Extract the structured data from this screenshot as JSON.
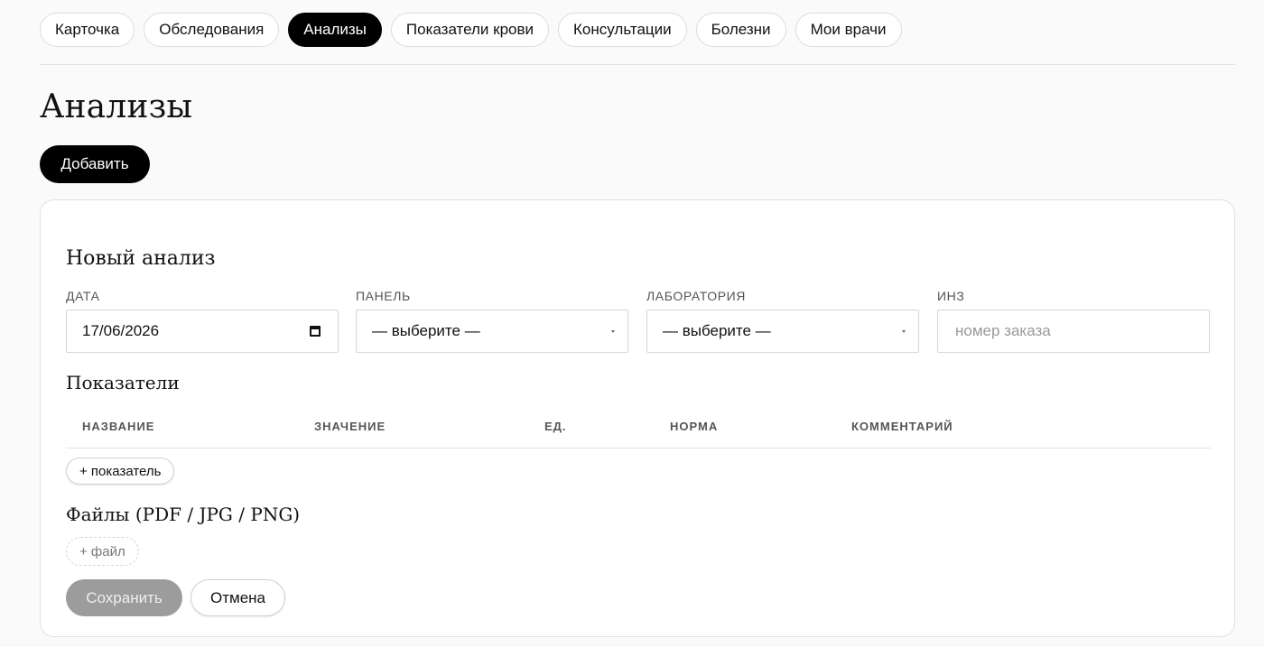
{
  "tabs": [
    {
      "label": "Карточка",
      "active": false
    },
    {
      "label": "Обследования",
      "active": false
    },
    {
      "label": "Анализы",
      "active": true
    },
    {
      "label": "Показатели крови",
      "active": false
    },
    {
      "label": "Консультации",
      "active": false
    },
    {
      "label": "Болезни",
      "active": false
    },
    {
      "label": "Мои врачи",
      "active": false
    }
  ],
  "page": {
    "title": "Анализы",
    "add_label": "Добавить"
  },
  "form": {
    "title": "Новый анализ",
    "date": {
      "label": "ДАТА",
      "value": "17/06/2026",
      "icon": "calendar-icon"
    },
    "panel": {
      "label": "ПАНЕЛЬ",
      "value": "— выберите —"
    },
    "lab": {
      "label": "ЛАБОРАТОРИЯ",
      "value": "— выберите —"
    },
    "inz": {
      "label": "ИНЗ",
      "placeholder": "номер заказа",
      "value": ""
    },
    "indicators": {
      "title": "Показатели",
      "columns": [
        "НАЗВАНИЕ",
        "ЗНАЧЕНИЕ",
        "ЕД.",
        "НОРМА",
        "КОММЕНТАРИЙ"
      ],
      "add_label": "+ показатель"
    },
    "files": {
      "title": "Файлы (PDF / JPG / PNG)",
      "add_label": "+ файл"
    },
    "save_label": "Сохранить",
    "cancel_label": "Отмена"
  },
  "colors": {
    "accent": "#000000",
    "background": "#fafafa",
    "disabled_button": "#9c9c9c"
  }
}
